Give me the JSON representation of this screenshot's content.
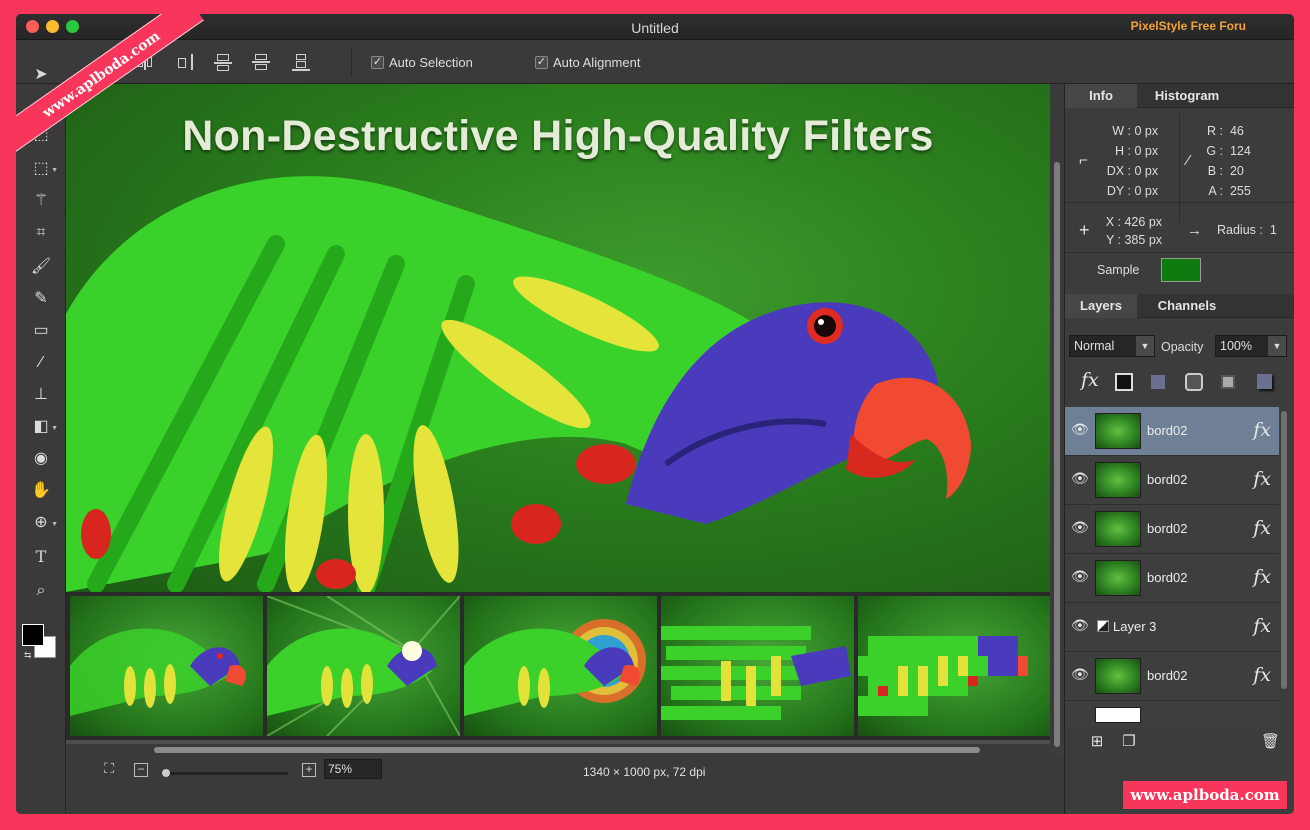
{
  "window": {
    "title": "Untitled",
    "brand": "PixelStyle Free Foru"
  },
  "optbar": {
    "auto_selection": {
      "label": "Auto Selection",
      "checked": true
    },
    "auto_alignment": {
      "label": "Auto Alignment",
      "checked": true
    }
  },
  "tools": [
    "move-tool",
    "transform-tool",
    "marquee-tool",
    "magic-wand-tool",
    "crop-tool",
    "brush-tool",
    "pencil-tool",
    "eraser-tool",
    "eyedropper-tool",
    "stamp-tool",
    "paint-bucket-tool",
    "red-eye-tool",
    "hand-tool",
    "zoom-tool",
    "text-tool",
    "search-tool"
  ],
  "colors": {
    "foreground": "#000000",
    "background": "#ffffff",
    "accent": "#f8355a"
  },
  "canvas": {
    "headline": "Non-Destructive High-Quality Filters"
  },
  "status": {
    "zoom": "75%",
    "document_info": "1340 × 1000 px, 72 dpi"
  },
  "info_panel": {
    "tabs": [
      "Info",
      "Histogram"
    ],
    "W": "0 px",
    "H": "0 px",
    "DX": "0 px",
    "DY": "0 px",
    "R": "46",
    "G": "124",
    "B": "20",
    "A": "255",
    "X": "426 px",
    "Y": "385 px",
    "radius_label": "Radius :",
    "radius": "1",
    "sample_label": "Sample",
    "sample_color": "#0e7a10"
  },
  "layers_panel": {
    "tabs": [
      "Layers",
      "Channels"
    ],
    "blend_mode": "Normal",
    "opacity_label": "Opacity",
    "opacity": "100%",
    "fx": "fx",
    "layers": [
      {
        "name": "bord02",
        "selected": true
      },
      {
        "name": "bord02",
        "selected": false
      },
      {
        "name": "bord02",
        "selected": false
      },
      {
        "name": "bord02",
        "selected": false
      },
      {
        "name": "Layer 3",
        "selected": false
      },
      {
        "name": "bord02",
        "selected": false
      }
    ]
  },
  "watermark": {
    "ribbon": "www.aplboda.com",
    "box": "www.aplboda.com"
  }
}
